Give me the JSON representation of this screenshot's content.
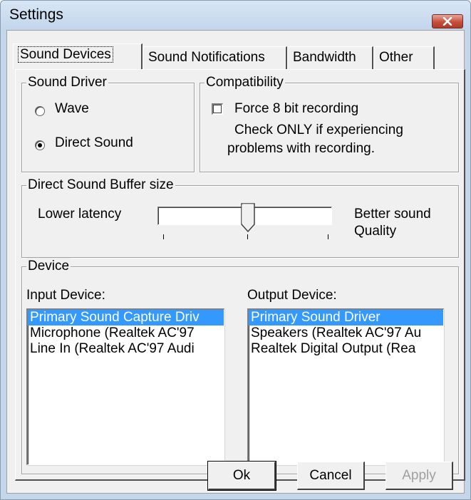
{
  "window": {
    "title": "Settings"
  },
  "tabs": [
    {
      "label": "Sound Devices",
      "active": true
    },
    {
      "label": "Sound Notifications",
      "active": false
    },
    {
      "label": "Bandwidth",
      "active": false
    },
    {
      "label": "Other",
      "active": false
    }
  ],
  "sound_driver": {
    "title": "Sound Driver",
    "options": [
      {
        "label": "Wave",
        "selected": false
      },
      {
        "label": "Direct Sound",
        "selected": true
      }
    ]
  },
  "compatibility": {
    "title": "Compatibility",
    "checkbox_label": "Force 8 bit recording",
    "checked": false,
    "note_line1": "Check ONLY if experiencing",
    "note_line2": "problems with recording."
  },
  "buffer": {
    "title": "Direct Sound Buffer size",
    "left_label": "Lower latency",
    "right_label_line1": "Better sound",
    "right_label_line2": "Quality",
    "slider_position_fraction": 0.5,
    "tick_count": 3
  },
  "device": {
    "title": "Device",
    "input_label": "Input Device:",
    "output_label": "Output Device:",
    "input_items": [
      {
        "label": "Primary Sound Capture Driv",
        "selected": true
      },
      {
        "label": "Microphone (Realtek AC'97",
        "selected": false
      },
      {
        "label": "Line In (Realtek AC'97 Audi",
        "selected": false
      }
    ],
    "output_items": [
      {
        "label": "Primary Sound Driver",
        "selected": true
      },
      {
        "label": "Speakers (Realtek AC'97 Au",
        "selected": false
      },
      {
        "label": "Realtek Digital Output (Rea",
        "selected": false
      }
    ]
  },
  "buttons": {
    "ok": "Ok",
    "cancel": "Cancel",
    "apply": "Apply"
  },
  "colors": {
    "selection": "#3399ff",
    "close_button": "#c74e3a",
    "titlebar": "#c4d6ea"
  },
  "icons": {
    "close": "close-x-icon"
  }
}
